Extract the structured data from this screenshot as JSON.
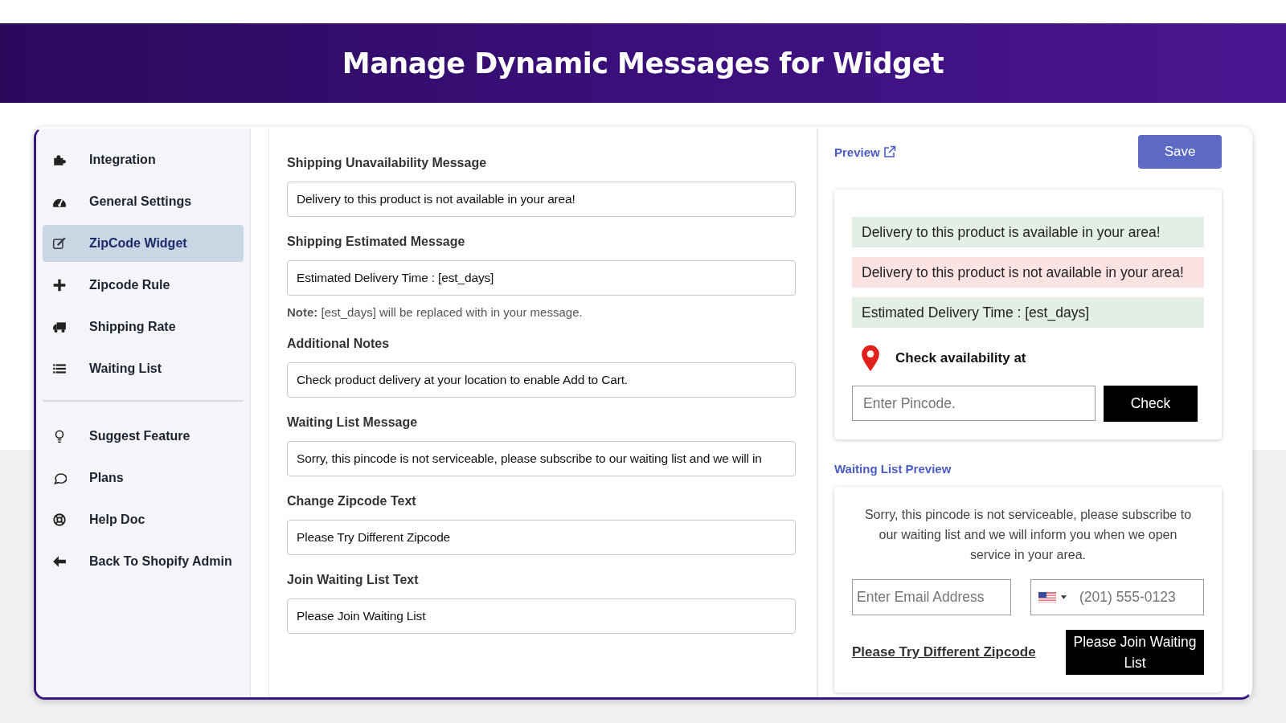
{
  "header": {
    "title": "Manage Dynamic Messages for Widget"
  },
  "sidebar": {
    "items": [
      {
        "label": "Integration",
        "selected": false
      },
      {
        "label": "General Settings",
        "selected": false
      },
      {
        "label": "ZipCode Widget",
        "selected": true
      },
      {
        "label": "Zipcode Rule",
        "selected": false
      },
      {
        "label": "Shipping Rate",
        "selected": false
      },
      {
        "label": "Waiting List",
        "selected": false
      }
    ],
    "footer_items": [
      {
        "label": "Suggest Feature"
      },
      {
        "label": "Plans"
      },
      {
        "label": "Help Doc"
      },
      {
        "label": "Back To Shopify Admin"
      }
    ]
  },
  "form": {
    "fields": [
      {
        "label": "Shipping Unavailability Message",
        "value": "Delivery to this product is not available in your area!"
      },
      {
        "label": "Shipping Estimated Message",
        "value": "Estimated Delivery Time : [est_days]",
        "note": "**Note:** [est_days] will be replaced with in your message."
      },
      {
        "label": "Additional Notes",
        "value": "Check product delivery at your location to enable Add to Cart."
      },
      {
        "label": "Waiting List Message",
        "value": "Sorry, this pincode is not serviceable, please subscribe to our waiting list and we will in"
      },
      {
        "label": "Change Zipcode Text",
        "value": "Please Try Different Zipcode"
      },
      {
        "label": "Join Waiting List Text",
        "value": "Please Join Waiting List"
      }
    ]
  },
  "preview": {
    "link": "Preview",
    "save_button": "Save",
    "messages": [
      {
        "kind": "success",
        "text": "Delivery to this product is available in your area!"
      },
      {
        "kind": "error",
        "text": "Delivery to this product is not available in your area!"
      },
      {
        "kind": "success",
        "text": "Estimated Delivery Time : [est_days]"
      }
    ],
    "check_label": "Check availability at",
    "pincode_placeholder": "Enter Pincode.",
    "check_button": "Check"
  },
  "waiting_list_preview": {
    "title": "Waiting List Preview",
    "message": "Sorry, this pincode is not serviceable, please subscribe to our waiting list and we will inform you when we open service in your area.",
    "email_placeholder": "Enter Email Address",
    "phone_placeholder": "(201) 555-0123",
    "change_zipcode_link": "Please Try Different Zipcode",
    "join_button": "Please Join Waiting List"
  }
}
